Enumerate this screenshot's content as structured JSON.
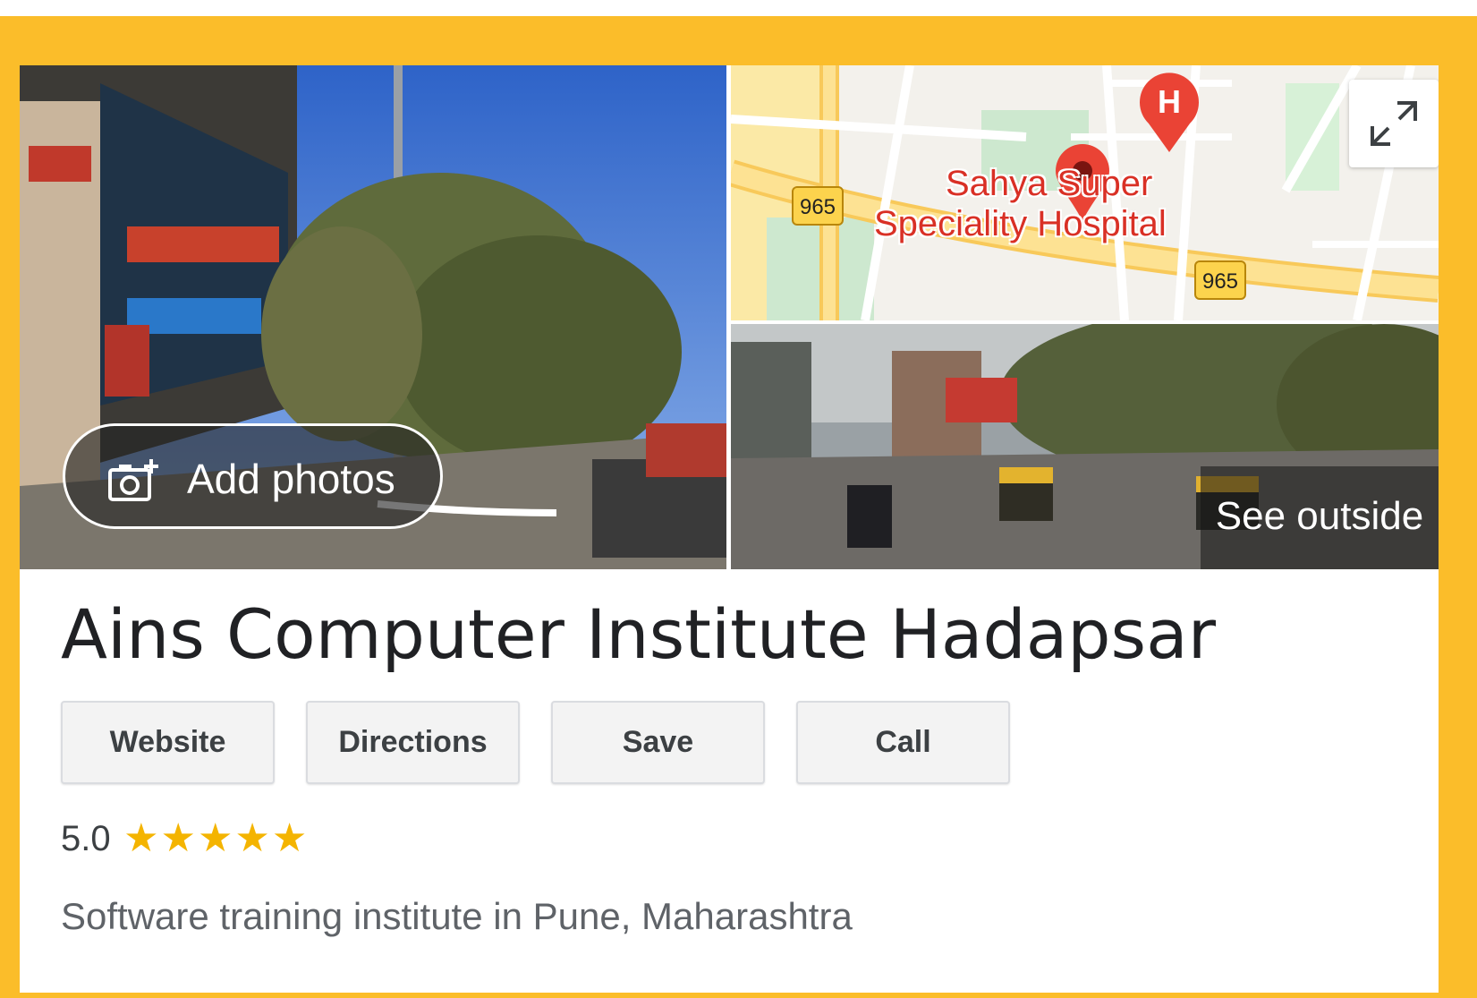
{
  "photos": {
    "add_photos_label": "Add photos",
    "see_outside_label": "See outside",
    "icons": [
      "add-photo-camera-icon",
      "expand-map-icon",
      "map-pin-icon",
      "hospital-icon"
    ]
  },
  "map": {
    "place_label_line1": "Sahya    Super",
    "place_label_line2": "Speciality Hospital",
    "hospital_marker": "H",
    "route_numbers": [
      "965",
      "965"
    ]
  },
  "business": {
    "name": "Ains Computer Institute Hadapsar",
    "rating": "5.0",
    "stars": "★★★★★",
    "category": "Software training institute in Pune, Maharashtra"
  },
  "actions": [
    "Website",
    "Directions",
    "Save",
    "Call"
  ],
  "colors": {
    "frame": "#fbbd2a",
    "title": "#202124",
    "star": "#f4b400",
    "map_label": "#d93025"
  }
}
